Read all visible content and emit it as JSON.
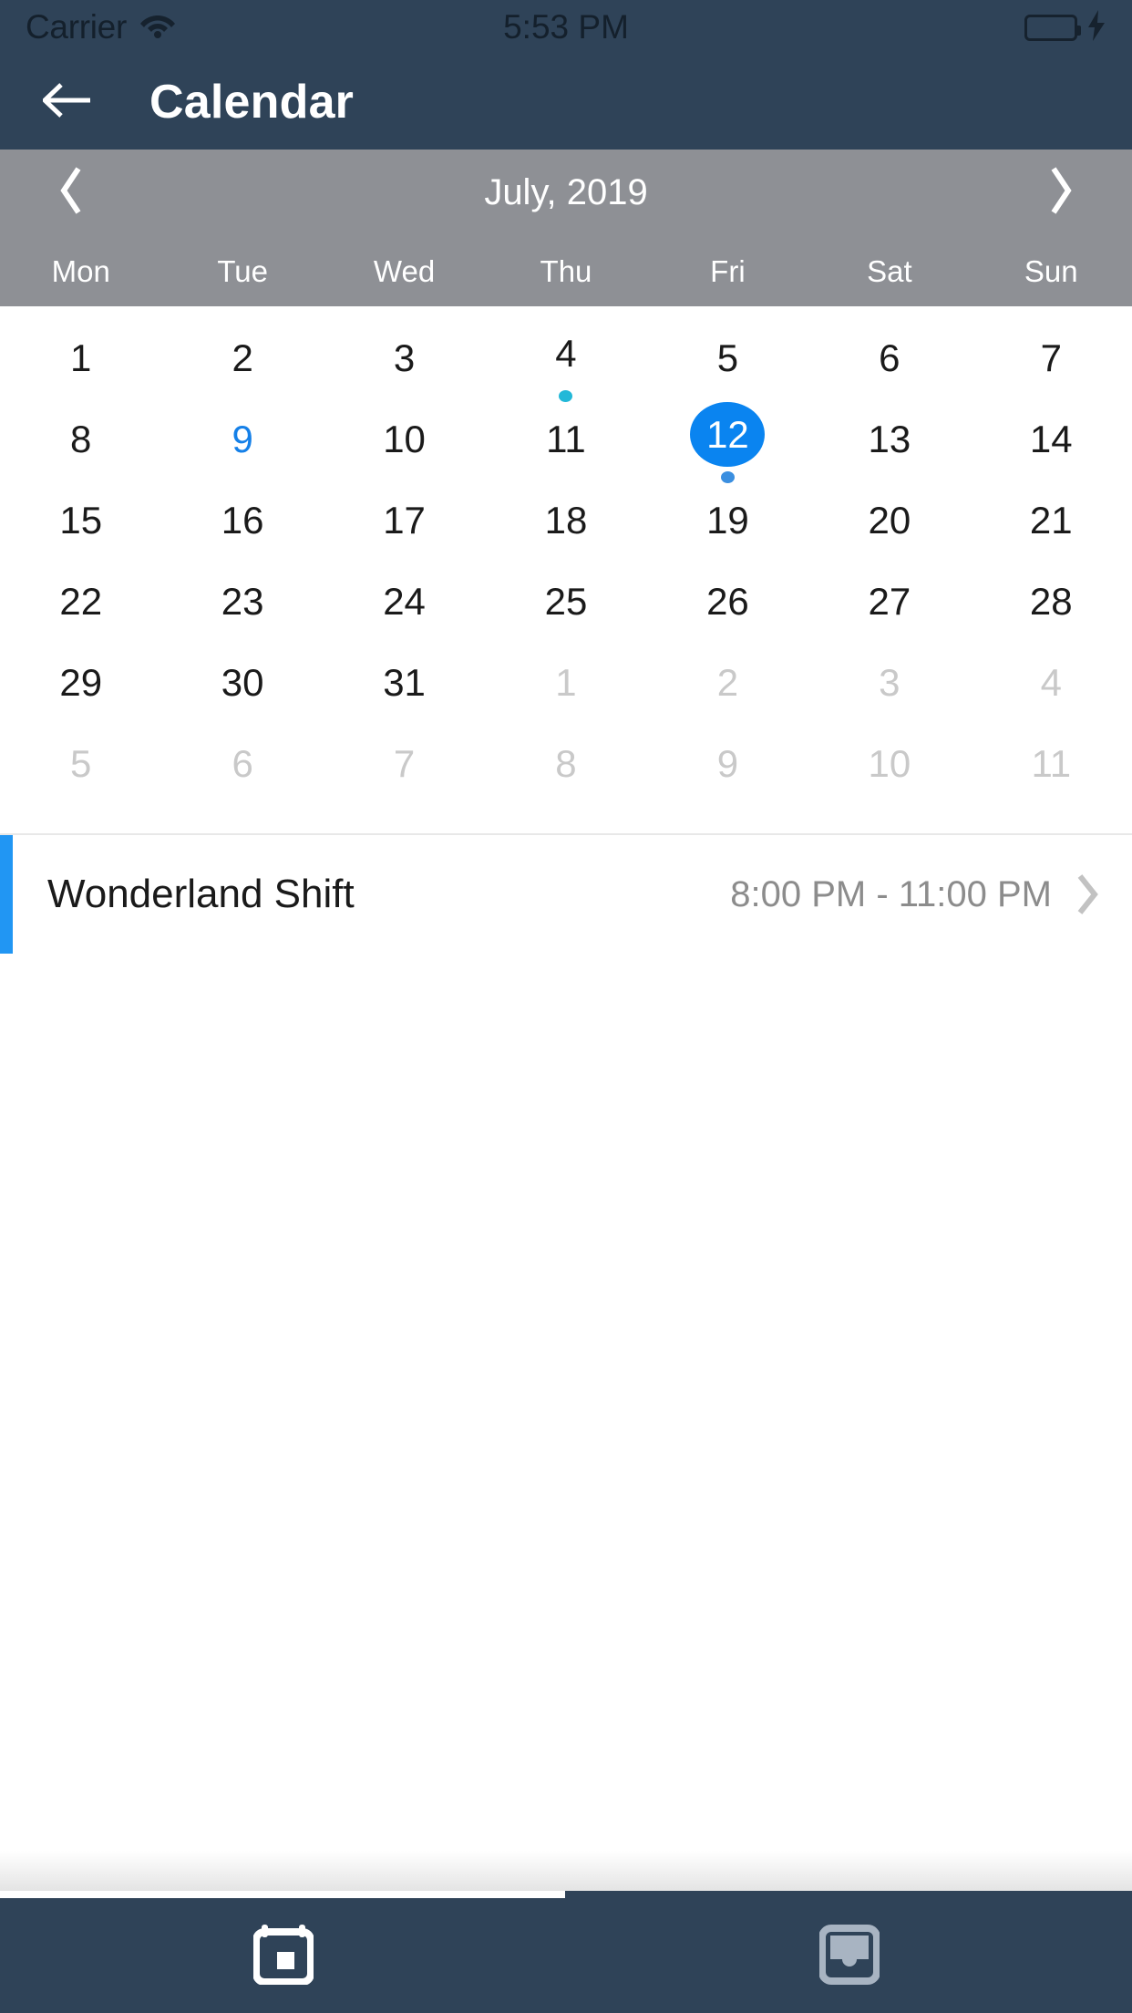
{
  "status_bar": {
    "carrier": "Carrier",
    "time": "5:53 PM",
    "wifi_icon": "wifi-icon",
    "battery_icon": "battery-icon",
    "charging_icon": "lightning-bolt-icon",
    "battery_color": "#4cd964"
  },
  "nav": {
    "back_icon": "arrow-left-icon",
    "title": "Calendar"
  },
  "calendar": {
    "prev_icon": "chevron-left-icon",
    "next_icon": "chevron-right-icon",
    "month_label": "July, 2019",
    "weekdays": [
      "Mon",
      "Tue",
      "Wed",
      "Thu",
      "Fri",
      "Sat",
      "Sun"
    ],
    "accent_color": "#0a84f0",
    "today_color": "#1580e8",
    "event_dot_color": "#22b8d8",
    "selected_dot_color": "#3b8fe0",
    "weeks": [
      [
        {
          "day": "1",
          "state": "current"
        },
        {
          "day": "2",
          "state": "current"
        },
        {
          "day": "3",
          "state": "current"
        },
        {
          "day": "4",
          "state": "current",
          "dot": "#22b8d8"
        },
        {
          "day": "5",
          "state": "current"
        },
        {
          "day": "6",
          "state": "current"
        },
        {
          "day": "7",
          "state": "current"
        }
      ],
      [
        {
          "day": "8",
          "state": "current"
        },
        {
          "day": "9",
          "state": "today"
        },
        {
          "day": "10",
          "state": "current"
        },
        {
          "day": "11",
          "state": "current"
        },
        {
          "day": "12",
          "state": "selected",
          "dot": "#3b8fe0"
        },
        {
          "day": "13",
          "state": "current"
        },
        {
          "day": "14",
          "state": "current"
        }
      ],
      [
        {
          "day": "15",
          "state": "current"
        },
        {
          "day": "16",
          "state": "current"
        },
        {
          "day": "17",
          "state": "current"
        },
        {
          "day": "18",
          "state": "current"
        },
        {
          "day": "19",
          "state": "current"
        },
        {
          "day": "20",
          "state": "current"
        },
        {
          "day": "21",
          "state": "current"
        }
      ],
      [
        {
          "day": "22",
          "state": "current"
        },
        {
          "day": "23",
          "state": "current"
        },
        {
          "day": "24",
          "state": "current"
        },
        {
          "day": "25",
          "state": "current"
        },
        {
          "day": "26",
          "state": "current"
        },
        {
          "day": "27",
          "state": "current"
        },
        {
          "day": "28",
          "state": "current"
        }
      ],
      [
        {
          "day": "29",
          "state": "current"
        },
        {
          "day": "30",
          "state": "current"
        },
        {
          "day": "31",
          "state": "current"
        },
        {
          "day": "1",
          "state": "other"
        },
        {
          "day": "2",
          "state": "other"
        },
        {
          "day": "3",
          "state": "other"
        },
        {
          "day": "4",
          "state": "other"
        }
      ],
      [
        {
          "day": "5",
          "state": "other"
        },
        {
          "day": "6",
          "state": "other"
        },
        {
          "day": "7",
          "state": "other"
        },
        {
          "day": "8",
          "state": "other"
        },
        {
          "day": "9",
          "state": "other"
        },
        {
          "day": "10",
          "state": "other"
        },
        {
          "day": "11",
          "state": "other"
        }
      ]
    ]
  },
  "events": [
    {
      "title": "Wonderland Shift",
      "time": "8:00 PM - 11:00 PM",
      "accent_color": "#2196f3",
      "chevron_icon": "chevron-right-icon"
    }
  ],
  "tab_bar": {
    "items": [
      {
        "icon": "calendar-icon",
        "active": true
      },
      {
        "icon": "inbox-icon",
        "active": false
      }
    ],
    "active_color": "#ffffff",
    "inactive_color": "#a8b4c2",
    "background": "#2f4358"
  }
}
